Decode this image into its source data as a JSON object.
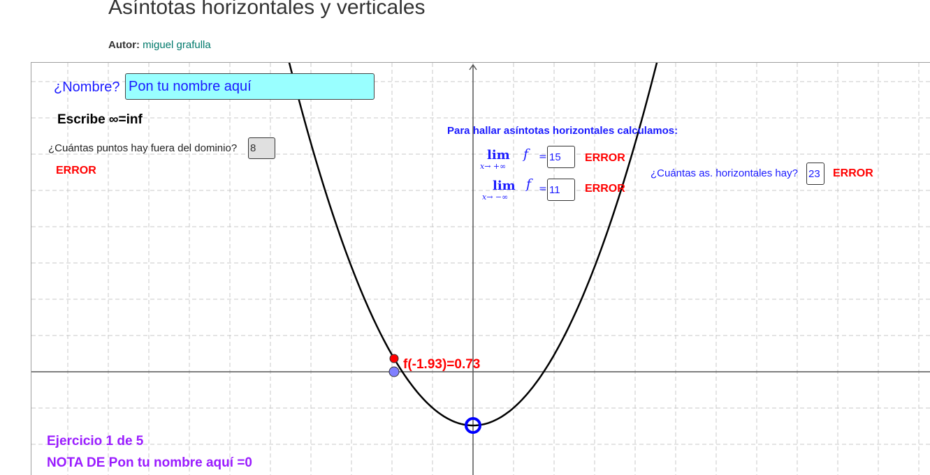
{
  "header": {
    "title": "Asíntotas horizontales y verticales",
    "author_label": "Autor:",
    "author_name": "miguel grafulla"
  },
  "applet": {
    "name_label": "¿Nombre?",
    "name_value": "Pon tu nombre aquí",
    "write_hint": "Escribe ∞=inf",
    "domain_question": "¿Cuántas puntos hay fuera del dominio?",
    "domain_answer": "8",
    "domain_status": "ERROR",
    "horizontal_title": "Para hallar asíntotas horizontales calculamos:",
    "limit_plus": {
      "lim": "lim",
      "sub": "x→ +∞",
      "fn": "f",
      "eq": "=",
      "value": "15",
      "status": "ERROR"
    },
    "limit_minus": {
      "lim": "lim",
      "sub": "x→ −∞",
      "fn": "f",
      "eq": "=",
      "value": "11",
      "status": "ERROR"
    },
    "horizontal_question": "¿Cuántas as. horizontales hay?",
    "horizontal_answer": "23",
    "horizontal_status": "ERROR",
    "point_label": "f(-1.93)=0.73",
    "exercise": "Ejercicio 1 de 5",
    "grade": "NOTA DE Pon tu nombre aquí =0"
  },
  "colors": {
    "curve": "#000000",
    "point_red": "#ff0000",
    "point_blue": "#7f7fff",
    "vertex_circle": "#0000ff",
    "input_bg": "#99ffff",
    "label_blue": "#1a1aff",
    "error_red": "#ff0000",
    "purple": "#9a1cff"
  }
}
